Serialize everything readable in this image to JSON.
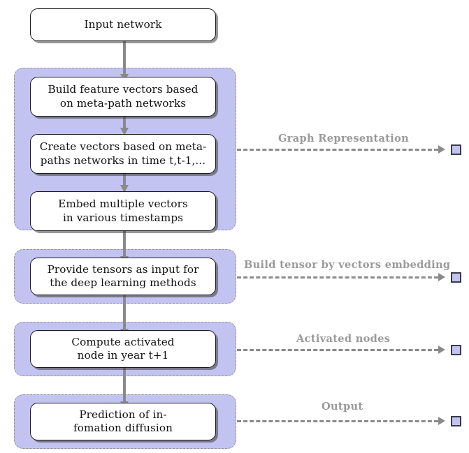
{
  "diagram": {
    "title": "Information diffusion prediction pipeline flowchart",
    "colors": {
      "group_fill": "#c3c3f2",
      "group_border": "#8f8f8f",
      "node_fill": "#ffffff",
      "node_border": "#1a1a1a",
      "connector": "#8a8a8a",
      "annotation_text": "#9a9a9a",
      "marker_fill": "#c3c3f2",
      "marker_border": "#3a3a4a"
    },
    "nodes": [
      {
        "id": "input-network",
        "label": "Input network"
      },
      {
        "id": "build-feature-vectors",
        "label": "Build feature vectors based\non meta-path networks"
      },
      {
        "id": "create-vectors",
        "label": "Create vectors based on meta-\npaths networks in time t,t-1,..."
      },
      {
        "id": "embed-vectors",
        "label": "Embed multiple vectors\nin various timestamps"
      },
      {
        "id": "provide-tensors",
        "label": "Provide tensors as input for\nthe deep learning methods"
      },
      {
        "id": "compute-activated",
        "label": "Compute activated\nnode in year t+1"
      },
      {
        "id": "prediction-diffusion",
        "label": "Prediction of in-\nfomation diffusion"
      }
    ],
    "annotations": [
      {
        "id": "graph-representation",
        "label": "Graph Representation"
      },
      {
        "id": "build-tensor",
        "label": "Build tensor by vectors embedding"
      },
      {
        "id": "activated-nodes",
        "label": "Activated nodes"
      },
      {
        "id": "output",
        "label": "Output"
      }
    ],
    "groups": [
      {
        "id": "graph-representation-group",
        "contains": [
          "build-feature-vectors",
          "create-vectors",
          "embed-vectors"
        ]
      },
      {
        "id": "tensor-group",
        "contains": [
          "provide-tensors"
        ]
      },
      {
        "id": "activation-group",
        "contains": [
          "compute-activated"
        ]
      },
      {
        "id": "output-group",
        "contains": [
          "prediction-diffusion"
        ]
      }
    ],
    "flow_order": [
      "input-network",
      "build-feature-vectors",
      "create-vectors",
      "embed-vectors",
      "provide-tensors",
      "compute-activated",
      "prediction-diffusion"
    ]
  }
}
